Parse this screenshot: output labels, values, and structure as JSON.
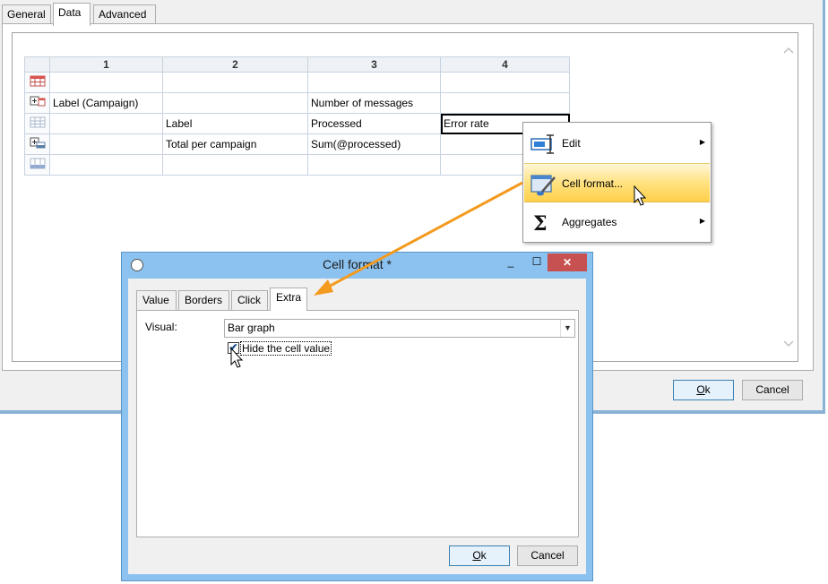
{
  "main": {
    "tabs": [
      "General",
      "Data",
      "Advanced"
    ],
    "columns": [
      "1",
      "2",
      "3",
      "4"
    ],
    "rows": [
      {
        "cells": [
          "",
          "",
          "",
          ""
        ]
      },
      {
        "cells": [
          "Label (Campaign)",
          "",
          "Number of messages",
          ""
        ]
      },
      {
        "cells": [
          "",
          "Label",
          "Processed",
          "Error rate"
        ]
      },
      {
        "cells": [
          "",
          "Total per campaign",
          "Sum(@processed)",
          ""
        ]
      },
      {
        "cells": [
          "",
          "",
          "",
          ""
        ]
      }
    ],
    "ok_label": "k",
    "ok_mnemonic": "O",
    "cancel_label": "Cancel"
  },
  "context_menu": {
    "items": [
      {
        "label": "Edit",
        "icon": "edit-cursor-icon",
        "submenu": true
      },
      {
        "label": "Cell format...",
        "icon": "paint-brush-icon",
        "submenu": false,
        "highlighted": true
      },
      {
        "label": "Aggregates",
        "icon": "sigma-icon",
        "submenu": true
      }
    ]
  },
  "dialog": {
    "title": "Cell format *",
    "tabs": [
      "Value",
      "Borders",
      "Click",
      "Extra"
    ],
    "visual_label": "Visual:",
    "visual_value": "Bar graph",
    "hide_cell_value_label": "Hide the cell value",
    "hide_cell_value_checked": true,
    "ok_label": "k",
    "ok_mnemonic": "O",
    "cancel_label": "Cancel"
  },
  "colors": {
    "accent_arrow": "#f39a1f",
    "window_frame": "#8cc2f0",
    "highlight": "#ffd04a",
    "close_button": "#c75050"
  }
}
